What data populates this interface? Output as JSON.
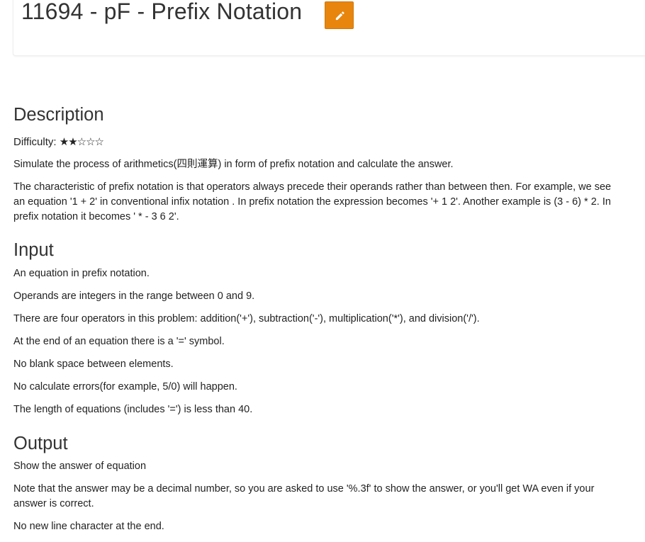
{
  "header": {
    "title": "11694 - pF - Prefix Notation",
    "accent_color": "#e8850c",
    "edit_icon": "pencil-icon"
  },
  "description": {
    "heading": "Description",
    "difficulty_label": "Difficulty:",
    "difficulty_stars": "★★☆☆☆",
    "difficulty_level": 2,
    "difficulty_max": 5,
    "paragraphs": [
      "Simulate the process of arithmetics(四則運算) in form of prefix notation and calculate the answer.",
      "The characteristic of prefix notation is that operators always precede their operands rather than between then. For example, we see an equation '1 + 2' in conventional infix notation . In prefix notation the expression becomes '+ 1 2'. Another example is (3 - 6) * 2. In prefix notation it becomes ' * - 3 6 2'."
    ]
  },
  "input": {
    "heading": "Input",
    "paragraphs": [
      "An equation in prefix notation.",
      "Operands are integers in the range between 0 and 9.",
      "There are four operators in this problem: addition('+'), subtraction('-'), multiplication('*'), and division('/').",
      "At the end of an equation there is a '=' symbol.",
      "No blank space between elements.",
      "No calculate errors(for example, 5/0) will happen.",
      "The length of equations (includes '=') is less than 40."
    ]
  },
  "output": {
    "heading": "Output",
    "paragraphs": [
      "Show the answer of equation",
      "Note that the answer may be a decimal number, so you are asked to use '%.3f' to show the answer, or you'll get WA even if your answer is correct.",
      "No new line character at the end."
    ]
  }
}
